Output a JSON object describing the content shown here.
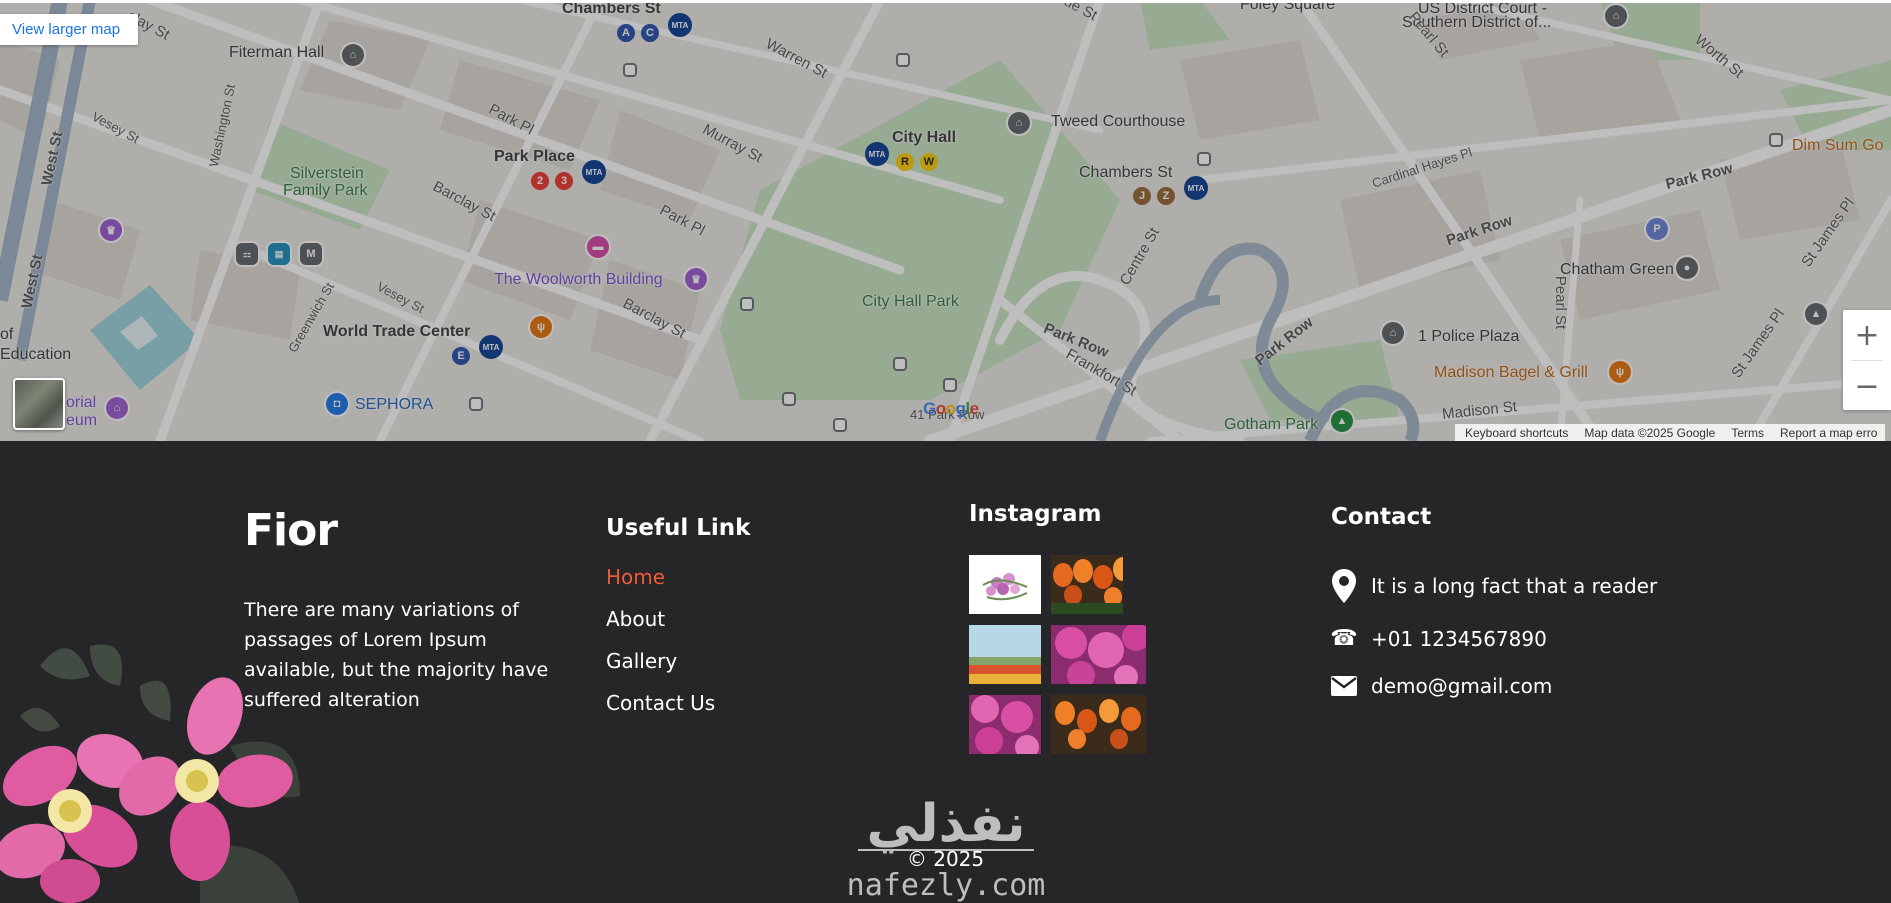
{
  "map": {
    "view_larger_map": "View larger map",
    "google_logo": "Google",
    "zoom_in": "+",
    "zoom_out": "−",
    "attribution": {
      "keyboard_shortcuts": "Keyboard shortcuts",
      "map_data": "Map data ©2025 Google",
      "terms": "Terms",
      "report": "Report a map erro"
    },
    "labels": {
      "chambers_st_1": "Chambers St",
      "chambers_st_2": "Chambers St",
      "warren_st": "Warren St",
      "murray_st": "Murray St",
      "park_pl_1": "Park Pl",
      "park_pl_2": "Park Pl",
      "park_place": "Park Place",
      "city_hall": "City Hall",
      "tweed": "Tweed Courthouse",
      "foley_square": "Foley Square",
      "us_district_court_1": "US District Court -",
      "us_district_court_2": "Southern District of...",
      "worth_st": "Worth St",
      "pearl_st": "Pearl St",
      "cardinal_hayes": "Cardinal Hayes Pl",
      "park_row_1": "Park Row",
      "park_row_2": "Park Row",
      "park_row_3": "Park Row",
      "park_row_4": "Park Row",
      "dim_sum": "Dim Sum Go",
      "st_james_pl": "St James Pl",
      "chatham_green": "Chatham Green",
      "one_police_plaza": "1 Police Plaza",
      "madison_bagel": "Madison Bagel & Grill",
      "madison_st": "Madison St",
      "pearl_st_2": "Pearl St",
      "gotham_park": "Gotham Park",
      "fiterman_hall": "Fiterman Hall",
      "vesey_st_1": "Vesey St",
      "vesey_st_2": "Vesey St",
      "west_st_1": "West St",
      "west_st_2": "West St",
      "washington_st": "Washington St",
      "silverstein_1": "Silverstein",
      "silverstein_2": "Family Park",
      "barclay_st_1": "Barclay St",
      "barclay_st_2": "Barclay St",
      "barclay_st_3": "Barclay St",
      "woolworth": "The Woolworth Building",
      "greenwich_st": "Greenwich St",
      "wtc": "World Trade Center",
      "education": "Education",
      "sephora": "SEPHORA",
      "memorial_1": "orial",
      "memorial_2": "eum",
      "city_hall_park": "City Hall Park",
      "centre_st": "Centre St",
      "frankfort_st": "Frankfort St",
      "park_row_41": "41 Park Row",
      "edge_st": "ue St",
      "clay_st": "clay St",
      "edge_cc": "cc",
      "of": "of"
    },
    "pins": {
      "line_a": "A",
      "line_c": "C",
      "line_2": "2",
      "line_3": "3",
      "line_r": "R",
      "line_w": "W",
      "line_j": "J",
      "line_z": "Z",
      "line_e": "E",
      "mta": "MTA",
      "path_m": "M",
      "bus_p": "P"
    }
  },
  "footer": {
    "brand": "Fior",
    "about": "There are many variations of passages of Lorem Ipsum available, but the majority have suffered alteration",
    "useful_link_title": "Useful Link",
    "links": [
      "Home",
      "About",
      "Gallery",
      "Contact Us"
    ],
    "instagram_title": "Instagram",
    "contact_title": "Contact",
    "contact": {
      "address": "It is a long fact that a reader",
      "phone": "+01 1234567890",
      "email": "demo@gmail.com"
    },
    "copyright": "© 2025",
    "watermark_arabic": "نفذلي",
    "watermark_domain": "nafezly.com",
    "colors": {
      "accent": "#f05a3a",
      "background": "#262628",
      "text": "#ffffff"
    }
  }
}
